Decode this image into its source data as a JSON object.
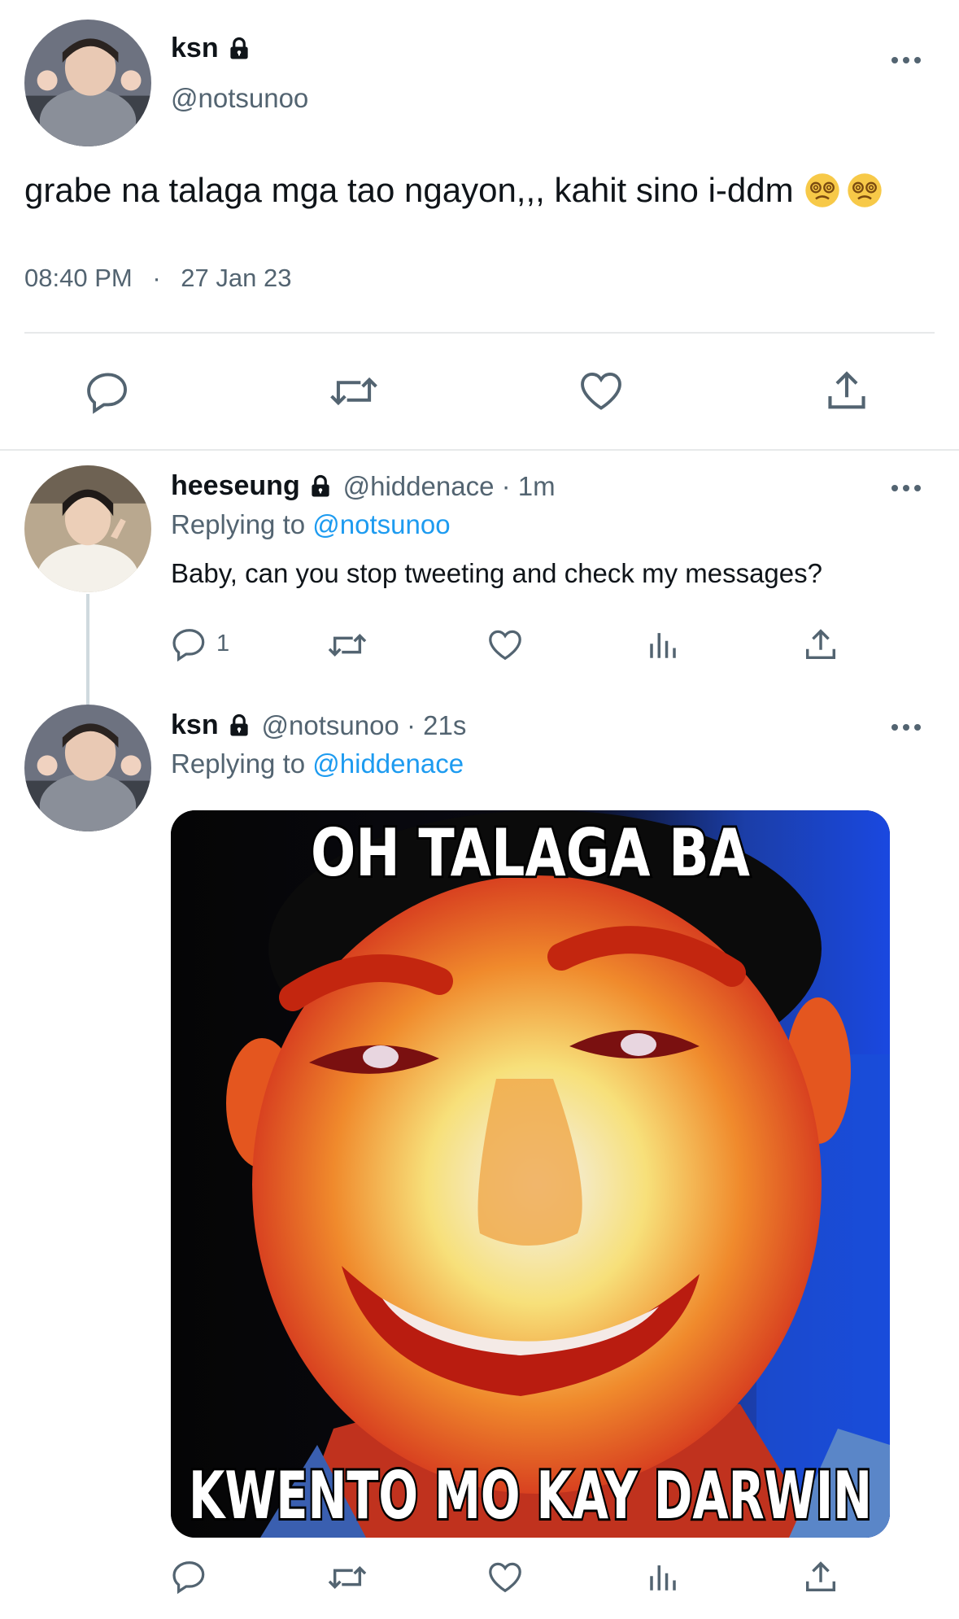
{
  "main_tweet": {
    "name": "ksn",
    "handle": "@notsunoo",
    "text": "grabe na talaga mga tao ngayon,,, kahit sino i-ddm",
    "emojis": [
      "dizzy-face-icon",
      "dizzy-face-icon"
    ],
    "time": "08:40 PM",
    "separator": "·",
    "date": "27 Jan 23",
    "actions": [
      "reply-icon",
      "retweet-icon",
      "like-icon",
      "share-icon"
    ]
  },
  "replies": [
    {
      "name": "heeseung",
      "handle": "@hiddenace",
      "meta_sep": " · ",
      "time": "1m",
      "replying_prefix": "Replying to ",
      "replying_to": "@notsunoo",
      "text": "Baby, can you stop tweeting and check my messages?",
      "reply_count": "1"
    },
    {
      "name": "ksn",
      "handle": "@notsunoo",
      "meta_sep": " · ",
      "time": "21s",
      "replying_prefix": "Replying to ",
      "replying_to": "@hiddenace",
      "media": {
        "top_text": "OH TALAGA BA",
        "bottom_text": "KWENTO MO KAY DARWIN"
      }
    }
  ],
  "colors": {
    "text_primary": "#0f1419",
    "text_secondary": "#536471",
    "link": "#1d9bf0",
    "divider": "#e7e9ea"
  }
}
